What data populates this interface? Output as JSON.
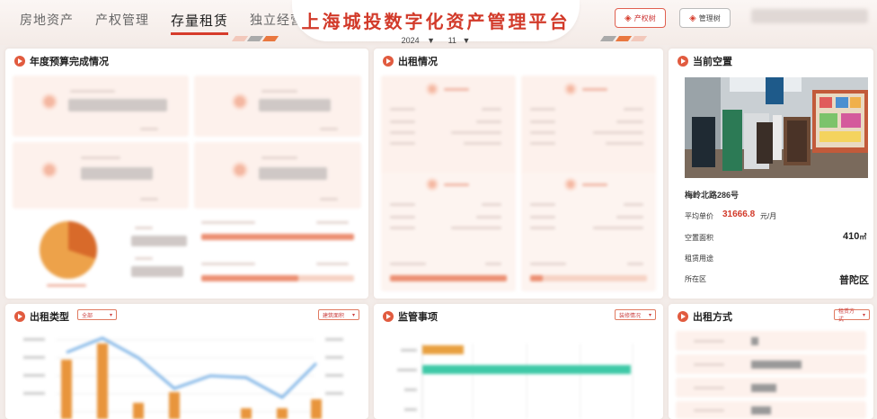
{
  "nav": {
    "items": [
      {
        "label": "房地资产",
        "active": false
      },
      {
        "label": "产权管理",
        "active": false
      },
      {
        "label": "存量租赁",
        "active": true
      },
      {
        "label": "独立经营",
        "active": false
      }
    ]
  },
  "header": {
    "title": "上海城投数字化资产管理平台",
    "year": "2024",
    "month": "11",
    "btn_property_tree": "产权树",
    "btn_manage_tree": "管理树"
  },
  "colors": {
    "accent": "#d23a2a",
    "orange": "#e8953c",
    "teal": "#3ec9a7",
    "pink_bg": "#fdf1ec"
  },
  "panels": {
    "budget": {
      "title": "年度预算完成情况"
    },
    "rental": {
      "title": "出租情况"
    },
    "vacancy": {
      "title": "当前空置",
      "address": "梅岭北路286号",
      "avg_price_label": "平均单价",
      "avg_price_value": "31666.8",
      "avg_price_unit": "元/月",
      "area_label": "空置面积",
      "area_value": "410",
      "area_unit": "㎡",
      "use_label": "租赁用途",
      "district_label": "所在区",
      "district_value": "普陀区"
    },
    "rent_type": {
      "title": "出租类型",
      "filter": "全部",
      "metric": "建筑面积"
    },
    "supervision": {
      "title": "监管事项",
      "filter": "装修情况"
    },
    "rent_mode": {
      "title": "出租方式",
      "filter": "租赁方式"
    }
  }
}
